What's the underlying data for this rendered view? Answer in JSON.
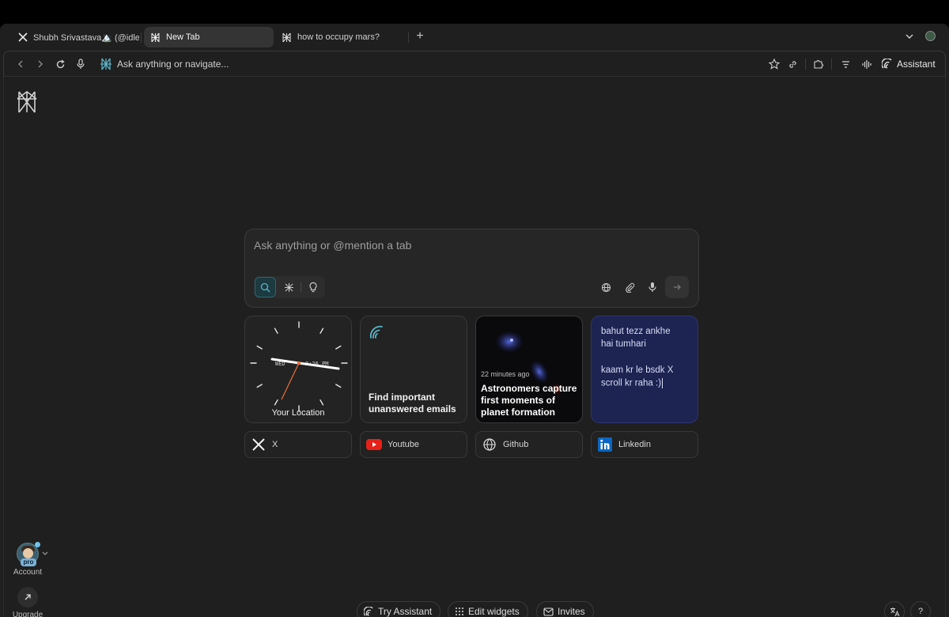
{
  "tabs": [
    {
      "title": "Shubh Srivastava🏔️ (@idles",
      "icon": "x-logo-icon",
      "active": false
    },
    {
      "title": "New Tab",
      "icon": "perplexity-logo-icon",
      "active": true
    },
    {
      "title": "how to occupy mars?",
      "icon": "perplexity-logo-icon",
      "active": false
    }
  ],
  "toolbar": {
    "omnibox_placeholder": "Ask anything or navigate...",
    "assistant_label": "Assistant"
  },
  "search": {
    "placeholder": "Ask anything or @mention a tab",
    "modes": [
      "search-icon",
      "research-icon",
      "lightbulb-icon"
    ]
  },
  "widgets": {
    "clock": {
      "day": "WED",
      "time": "8:26 PM",
      "label": "Your Location"
    },
    "email": {
      "text": "Find important unanswered emails"
    },
    "news": {
      "time": "22 minutes ago",
      "headline": "Astronomers capture first moments of planet formation"
    },
    "note": {
      "line1": "bahut tezz ankhe",
      "line2": "hai tumhari",
      "line3": "kaam kr le bsdk X",
      "line4": "scroll kr raha :)"
    }
  },
  "shortcuts": [
    {
      "label": "X",
      "icon": "x-logo-icon"
    },
    {
      "label": "Youtube",
      "icon": "youtube-icon"
    },
    {
      "label": "Github",
      "icon": "globe-icon"
    },
    {
      "label": "Linkedin",
      "icon": "linkedin-icon"
    }
  ],
  "sidebar": {
    "account_label": "Account",
    "pro_badge": "pro",
    "upgrade_label": "Upgrade"
  },
  "bottom": {
    "try_assistant": "Try Assistant",
    "edit_widgets": "Edit widgets",
    "invites": "Invites",
    "help": "?"
  },
  "colors": {
    "background": "#1f1f1f",
    "accent": "#5ab4c8",
    "note_bg": "#1d2452",
    "youtube": "#e62117",
    "linkedin": "#0a66c2"
  }
}
